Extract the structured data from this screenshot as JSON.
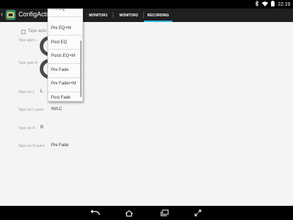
{
  "status_bar": {
    "time": "22:19",
    "icons": [
      "bluetooth-icon",
      "wifi-icon",
      "battery-icon"
    ]
  },
  "action_bar": {
    "app_title": "ConfigActivity",
    "tabs": [
      {
        "label": "MONITOR1",
        "active": false
      },
      {
        "label": "MONITOR2",
        "active": false
      },
      {
        "label": "RECORDING",
        "active": true
      }
    ],
    "accent_color": "#33b5e5"
  },
  "main": {
    "checkbox_label": "Tape auto",
    "rows": [
      {
        "label": "Tape gain L",
        "value": ""
      },
      {
        "label": "Tape gain R",
        "value": ""
      },
      {
        "label": "Tape src L",
        "value": "L"
      },
      {
        "label": "Tape src L point",
        "value": "IN/LC"
      },
      {
        "label": "Tape src R",
        "value": "R"
      },
      {
        "label": "Tape src R point",
        "value": "Pre Fade"
      }
    ]
  },
  "dropdown": {
    "items": [
      "Pre EQ",
      "Pre EQ+M",
      "Post EQ",
      "Posts EQ+M",
      "Pre Fade",
      "Pre Fader+M",
      "Post Fade"
    ]
  },
  "nav_bar": {
    "buttons": [
      "back-icon",
      "home-icon",
      "recents-icon",
      "fullscreen-icon"
    ]
  }
}
